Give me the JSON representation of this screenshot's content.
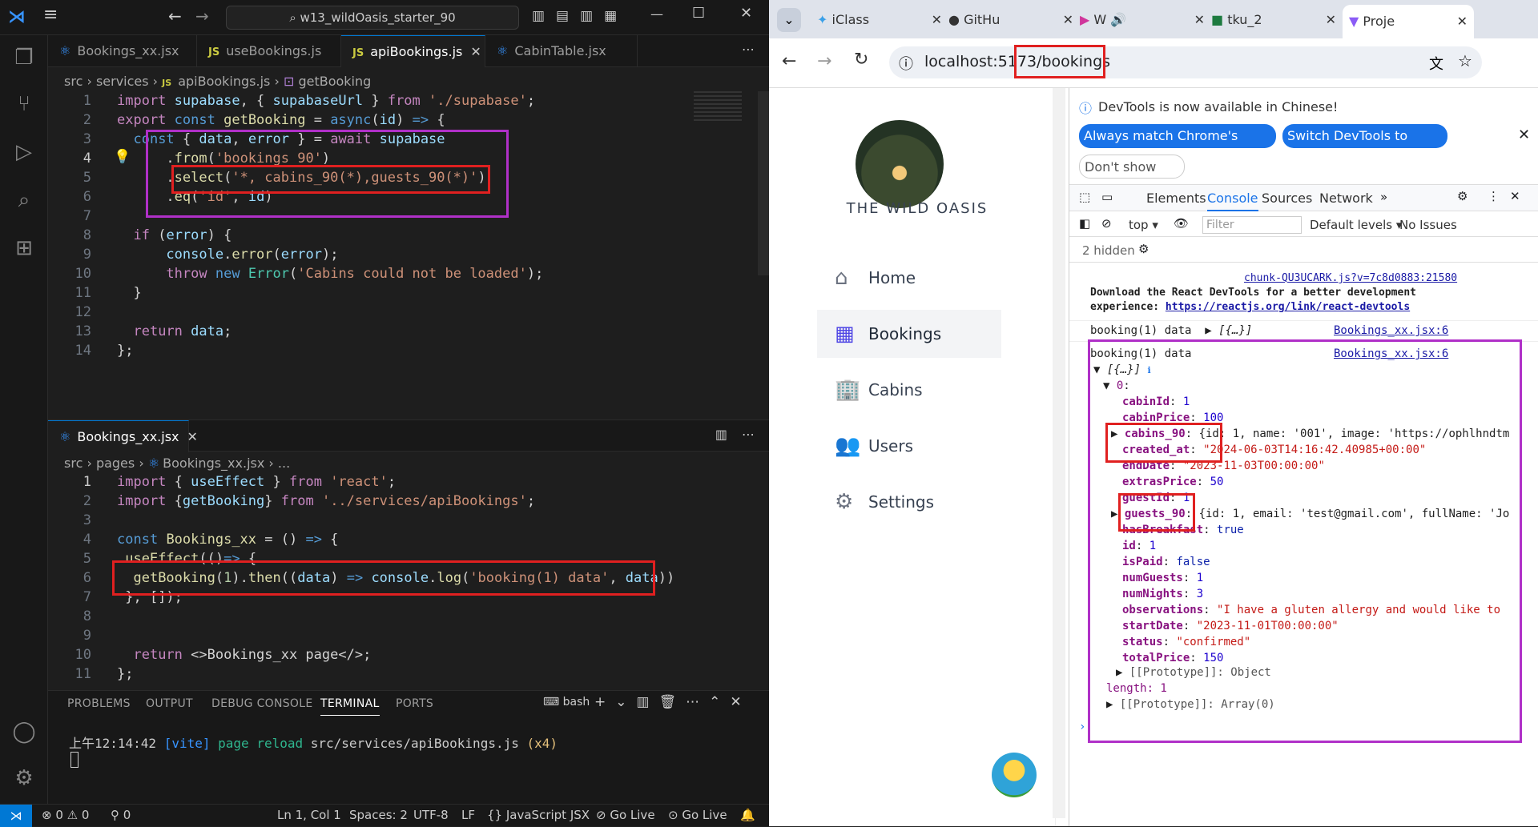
{
  "vscode": {
    "search_text": "w13_wildOasis_starter_90",
    "top_tabs": [
      {
        "label": "Bookings_xx.jsx",
        "kind": "react"
      },
      {
        "label": "useBookings.js",
        "kind": "js"
      },
      {
        "label": "apiBookings.js",
        "kind": "js",
        "active": true
      },
      {
        "label": "CabinTable.jsx",
        "kind": "react"
      }
    ],
    "top_breadcrumb": [
      "src",
      "services",
      "apiBookings.js",
      "getBooking"
    ],
    "top_code": [
      [
        "1",
        "import supabase, { supabaseUrl } from './supabase';"
      ],
      [
        "2",
        "export const getBooking = async(id) => {"
      ],
      [
        "3",
        "  const { data, error } = await supabase"
      ],
      [
        "4",
        "    .from('bookings_90')"
      ],
      [
        "5",
        "    .select('*, cabins_90(*),guests_90(*)')"
      ],
      [
        "6",
        "    .eq('id', id)"
      ],
      [
        "7",
        ""
      ],
      [
        "8",
        "  if (error) {"
      ],
      [
        "9",
        "    console.error(error);"
      ],
      [
        "10",
        "    throw new Error('Cabins could not be loaded');"
      ],
      [
        "11",
        "  }"
      ],
      [
        "12",
        ""
      ],
      [
        "13",
        "  return data;"
      ],
      [
        "14",
        "};"
      ]
    ],
    "bottom_tab": "Bookings_xx.jsx",
    "bottom_breadcrumb": [
      "src",
      "pages",
      "Bookings_xx.jsx",
      "..."
    ],
    "bottom_code": [
      [
        "1",
        "import { useEffect } from 'react';"
      ],
      [
        "2",
        "import {getBooking} from '../services/apiBookings';"
      ],
      [
        "3",
        ""
      ],
      [
        "4",
        "const Bookings_xx = () => {"
      ],
      [
        "5",
        " useEffect(()=> {"
      ],
      [
        "6",
        "  getBooking(1).then((data) => console.log('booking(1) data', data))"
      ],
      [
        "7",
        " }, []);"
      ],
      [
        "8",
        ""
      ],
      [
        "9",
        ""
      ],
      [
        "10",
        "  return <>Bookings_xx page</>;"
      ],
      [
        "11",
        "};"
      ]
    ],
    "panel_tabs": [
      "PROBLEMS",
      "OUTPUT",
      "DEBUG CONSOLE",
      "TERMINAL",
      "PORTS"
    ],
    "shell": "bash",
    "terminal_line": {
      "time": "上午12:14:42",
      "tag": "[vite]",
      "msg": "page reload",
      "path": "src/services/apiBookings.js",
      "count": "(x4)"
    },
    "status": {
      "errors": "0",
      "warnings": "0",
      "ports": "0",
      "position": "Ln 1, Col 1",
      "spaces": "Spaces: 2",
      "encoding": "UTF-8",
      "eol": "LF",
      "language": "JavaScript JSX",
      "golive1": "Go Live",
      "golive2": "Go Live"
    }
  },
  "browser": {
    "tabs": [
      "iClass",
      "GitHu",
      "W",
      "tku_2",
      "Proje"
    ],
    "url_host": "localhost:5173",
    "url_path": "/bookings",
    "app_name": "THE WILD OASIS",
    "nav": [
      "Home",
      "Bookings",
      "Cabins",
      "Users",
      "Settings"
    ],
    "selected_nav": "Bookings",
    "devtools": {
      "notice": "DevTools is now available in Chinese!",
      "btn1": "Always match Chrome's language",
      "btn2": "Switch DevTools to Chinese",
      "btn3": "Don't show again",
      "tabs": [
        "Elements",
        "Console",
        "Sources",
        "Network"
      ],
      "active_tab": "Console",
      "context": "top",
      "filter_placeholder": "Filter",
      "levels": "Default levels",
      "issues": "No Issues",
      "hidden": "2 hidden",
      "chunk_link": "chunk-QU3UCARK.js?v=7c8d0883:21580",
      "react_msg1": "Download the React DevTools for a better development",
      "react_msg2": "experience: ",
      "react_link": "https://reactjs.org/link/react-devtools",
      "log_label": "booking(1) data",
      "log_src": "Bookings_xx.jsx:6",
      "collapsed": "[{…}]",
      "fields": [
        {
          "k": "cabinId",
          "v": "1",
          "t": "num"
        },
        {
          "k": "cabinPrice",
          "v": "100",
          "t": "num"
        },
        {
          "k": "cabins_90",
          "v": "{id: 1, name: '001', image: 'https://ophlhndtm",
          "t": "obj"
        },
        {
          "k": "created_at",
          "v": "\"2024-06-03T14:16:42.40985+00:00\"",
          "t": "str"
        },
        {
          "k": "endDate",
          "v": "\"2023-11-03T00:00:00\"",
          "t": "str"
        },
        {
          "k": "extrasPrice",
          "v": "50",
          "t": "num"
        },
        {
          "k": "guestId",
          "v": "1",
          "t": "num"
        },
        {
          "k": "guests_90",
          "v": "{id: 1, email: 'test@gmail.com', fullName: 'Jo",
          "t": "obj"
        },
        {
          "k": "hasBreakfast",
          "v": "true",
          "t": "bool"
        },
        {
          "k": "id",
          "v": "1",
          "t": "num"
        },
        {
          "k": "isPaid",
          "v": "false",
          "t": "bool"
        },
        {
          "k": "numGuests",
          "v": "1",
          "t": "num"
        },
        {
          "k": "numNights",
          "v": "3",
          "t": "num"
        },
        {
          "k": "observations",
          "v": "\"I have a gluten allergy and would like to",
          "t": "str"
        },
        {
          "k": "startDate",
          "v": "\"2023-11-01T00:00:00\"",
          "t": "str"
        },
        {
          "k": "status",
          "v": "\"confirmed\"",
          "t": "str"
        },
        {
          "k": "totalPrice",
          "v": "150",
          "t": "num"
        }
      ],
      "proto_obj": "[[Prototype]]: Object",
      "length": "length: 1",
      "proto_arr": "[[Prototype]]: Array(0)"
    }
  }
}
